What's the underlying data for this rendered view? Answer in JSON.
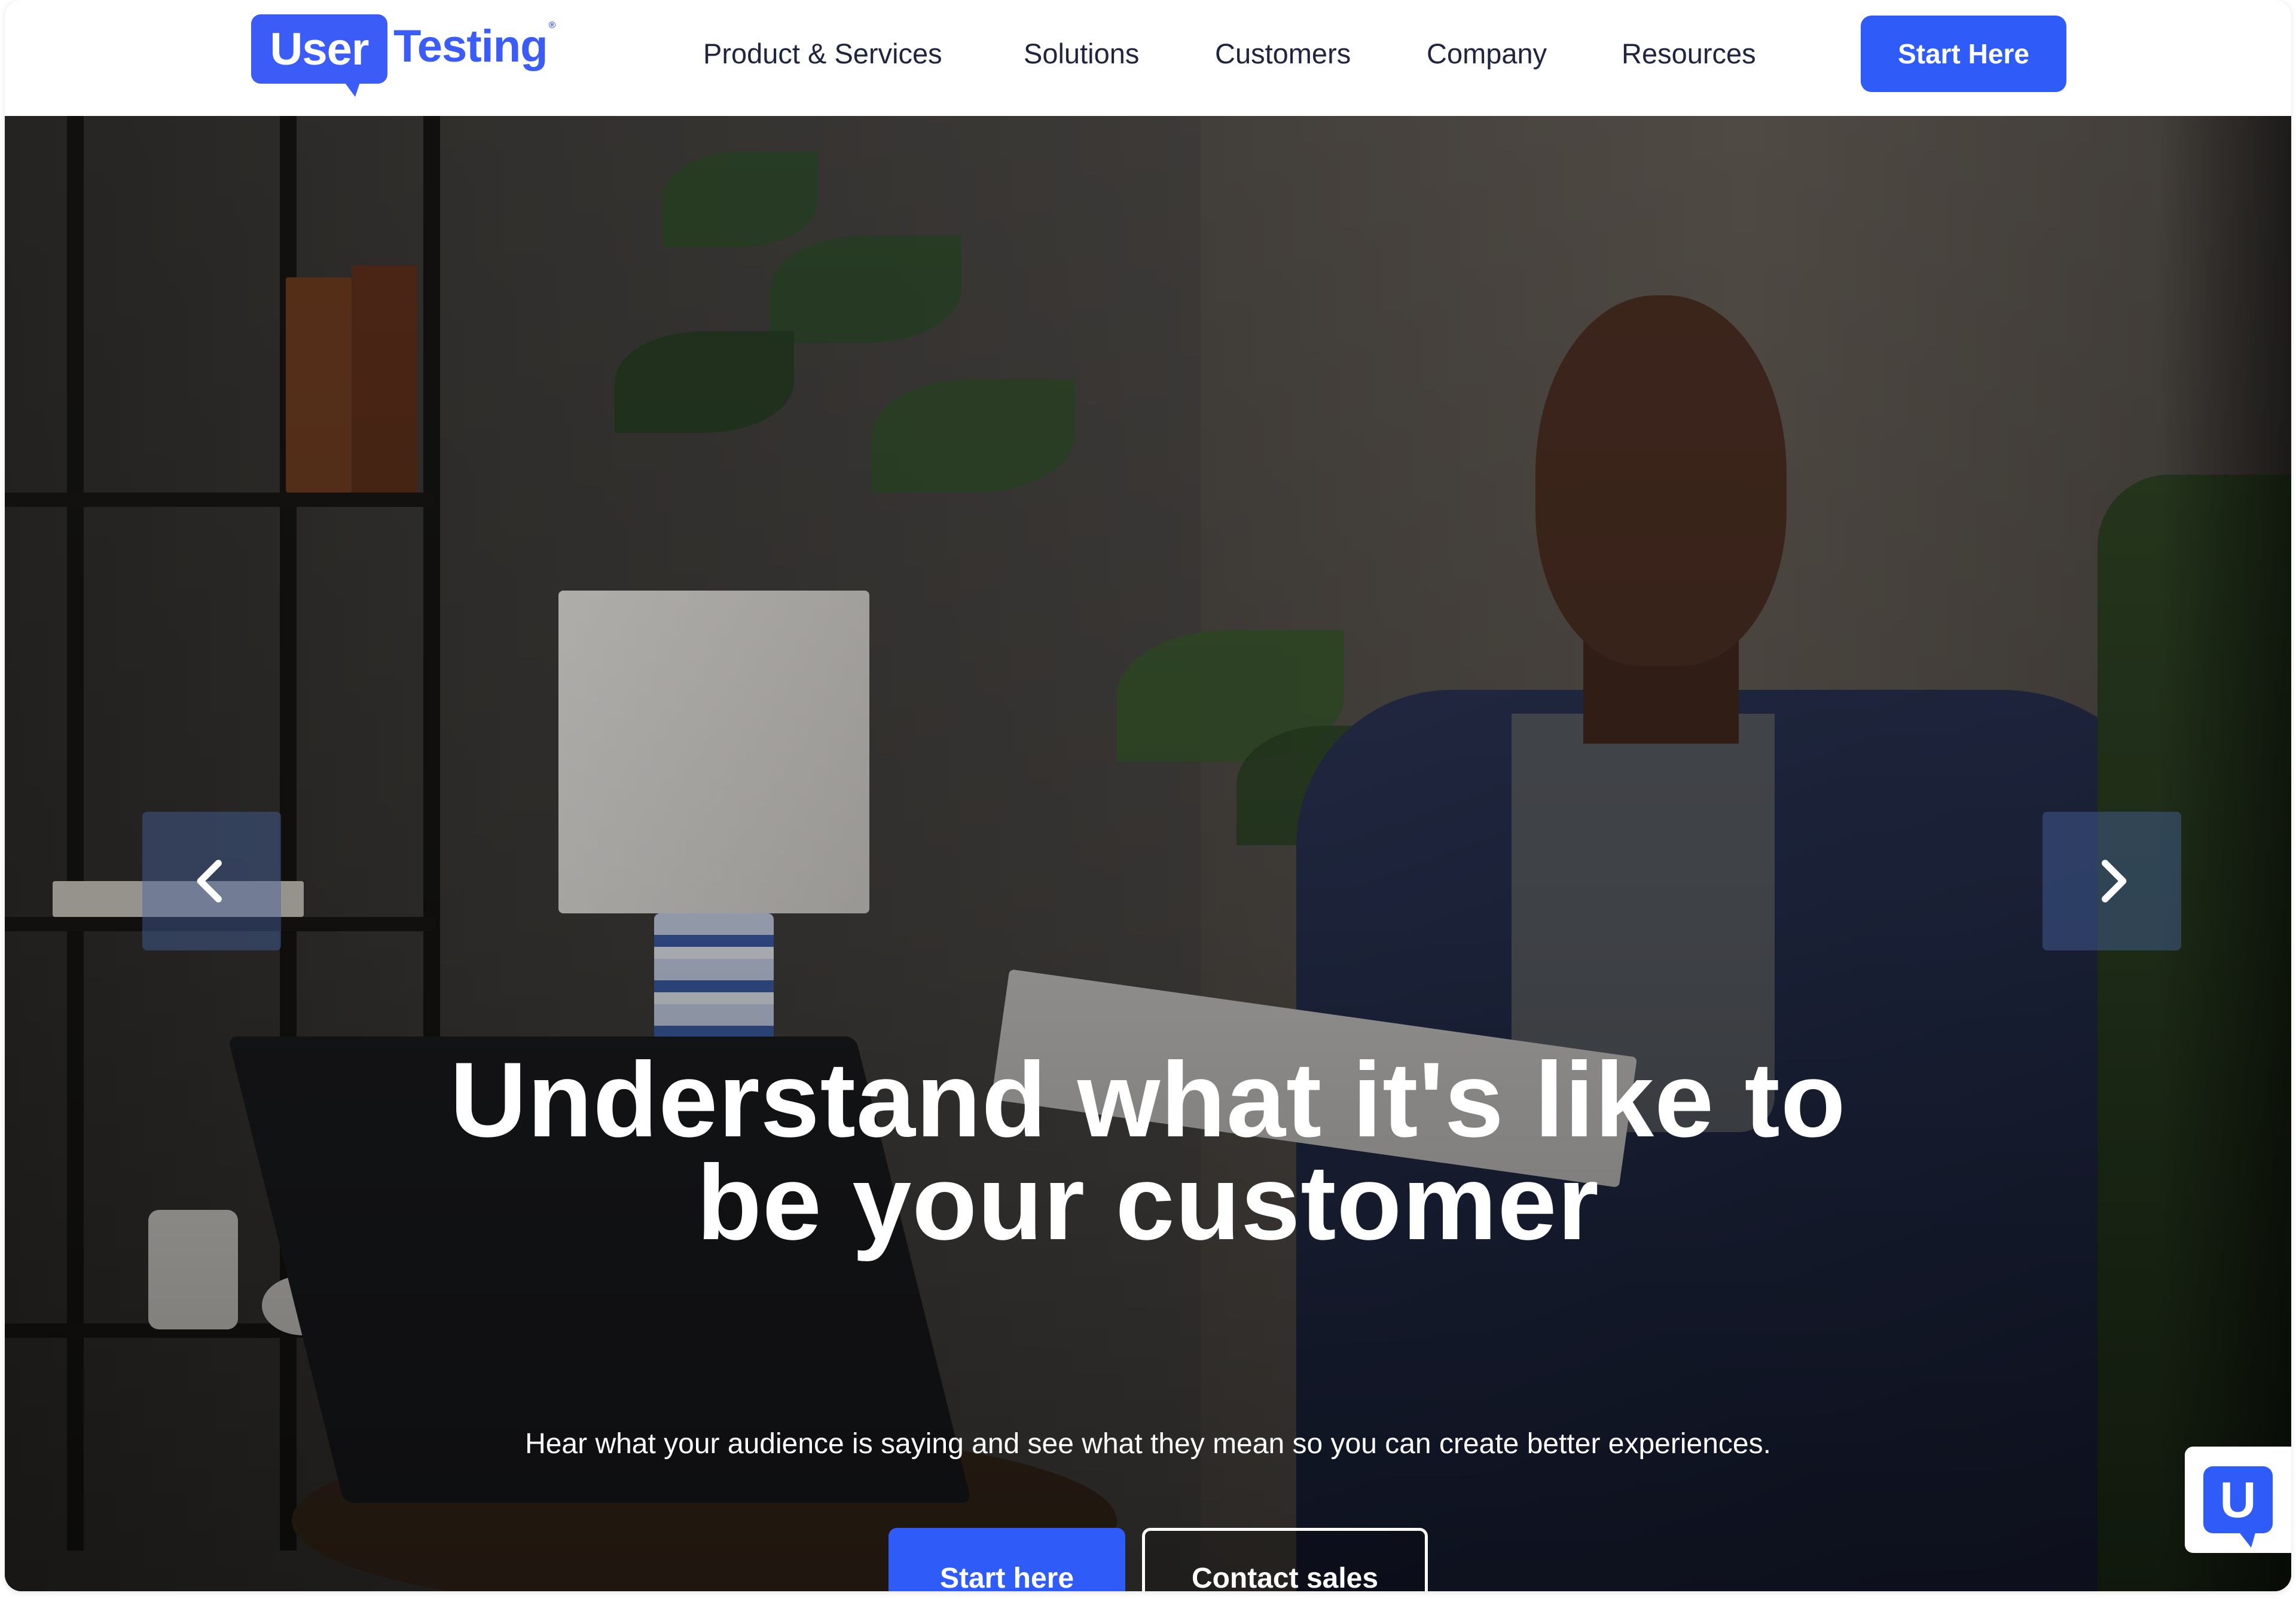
{
  "header": {
    "logo": {
      "part1": "User",
      "part2": "Testing",
      "mark": "®"
    },
    "nav": [
      {
        "label": "Product & Services"
      },
      {
        "label": "Solutions"
      },
      {
        "label": "Customers"
      },
      {
        "label": "Company"
      },
      {
        "label": "Resources"
      }
    ],
    "cta_label": "Start Here"
  },
  "hero": {
    "title_line1": "Understand what it's like to",
    "title_line2": "be your customer",
    "subtitle": "Hear what your audience is saying and see what they mean so you can create better experiences.",
    "primary_cta": "Start here",
    "secondary_cta": "Contact sales",
    "prev_icon": "chevron-left-icon",
    "next_icon": "chevron-right-icon"
  },
  "chat_widget": {
    "glyph": "U",
    "icon": "usertesting-chat-icon"
  },
  "colors": {
    "brand_blue": "#2f5cf8",
    "nav_text": "#1f2540",
    "white": "#ffffff"
  }
}
